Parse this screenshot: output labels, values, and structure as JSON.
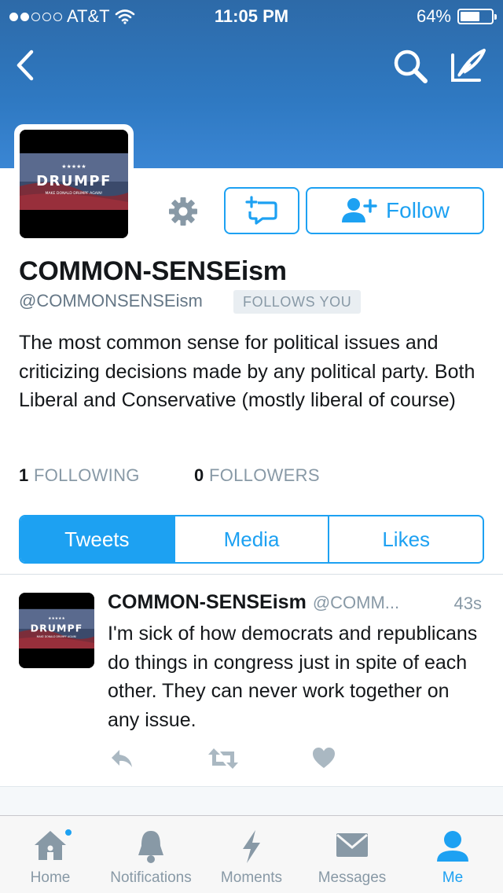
{
  "status_bar": {
    "carrier": "AT&T",
    "signal_bars_filled": 2,
    "signal_bars_total": 5,
    "time": "11:05 PM",
    "battery": "64%",
    "battery_level": 0.64
  },
  "colors": {
    "accent": "#1da1f2",
    "header_top": "#2d6aa8",
    "header_bottom": "#3a86d4",
    "muted": "#8899a6"
  },
  "nav": {
    "back_icon": "chevron-left-icon",
    "search_icon": "search-icon",
    "compose_icon": "compose-icon"
  },
  "avatar_image": {
    "stars": "★★★★★",
    "title": "DRUMPF",
    "subtitle": "MAKE DONALD DRUMPF AGAIN!"
  },
  "actions": {
    "gear_icon": "gear-icon",
    "dm_icon": "direct-message-icon",
    "follow_label": "Follow",
    "follow_icon": "add-user-icon"
  },
  "profile": {
    "name": "COMMON-SENSEism",
    "handle": "@COMMONSENSEism",
    "follows_you": "FOLLOWS YOU",
    "bio": "The most common sense for political issues and criticizing decisions made by any political party. Both Liberal and Conservative (mostly liberal of course)",
    "following_count": "1",
    "following_label": "FOLLOWING",
    "followers_count": "0",
    "followers_label": "FOLLOWERS"
  },
  "tabs": [
    {
      "label": "Tweets",
      "selected": true
    },
    {
      "label": "Media",
      "selected": false
    },
    {
      "label": "Likes",
      "selected": false
    }
  ],
  "tweet": {
    "name": "COMMON-SENSEism",
    "handle": "@COMM...",
    "time": "43s",
    "text": "I'm sick of how democrats and republicans do things in congress just in spite of each other. They can never work together on any issue.",
    "actions": [
      "reply-icon",
      "retweet-icon",
      "like-icon"
    ]
  },
  "tab_bar": [
    {
      "label": "Home",
      "icon": "home-icon",
      "active": false,
      "badge": true
    },
    {
      "label": "Notifications",
      "icon": "bell-icon",
      "active": false
    },
    {
      "label": "Moments",
      "icon": "lightning-icon",
      "active": false
    },
    {
      "label": "Messages",
      "icon": "envelope-icon",
      "active": false
    },
    {
      "label": "Me",
      "icon": "person-icon",
      "active": true
    }
  ]
}
